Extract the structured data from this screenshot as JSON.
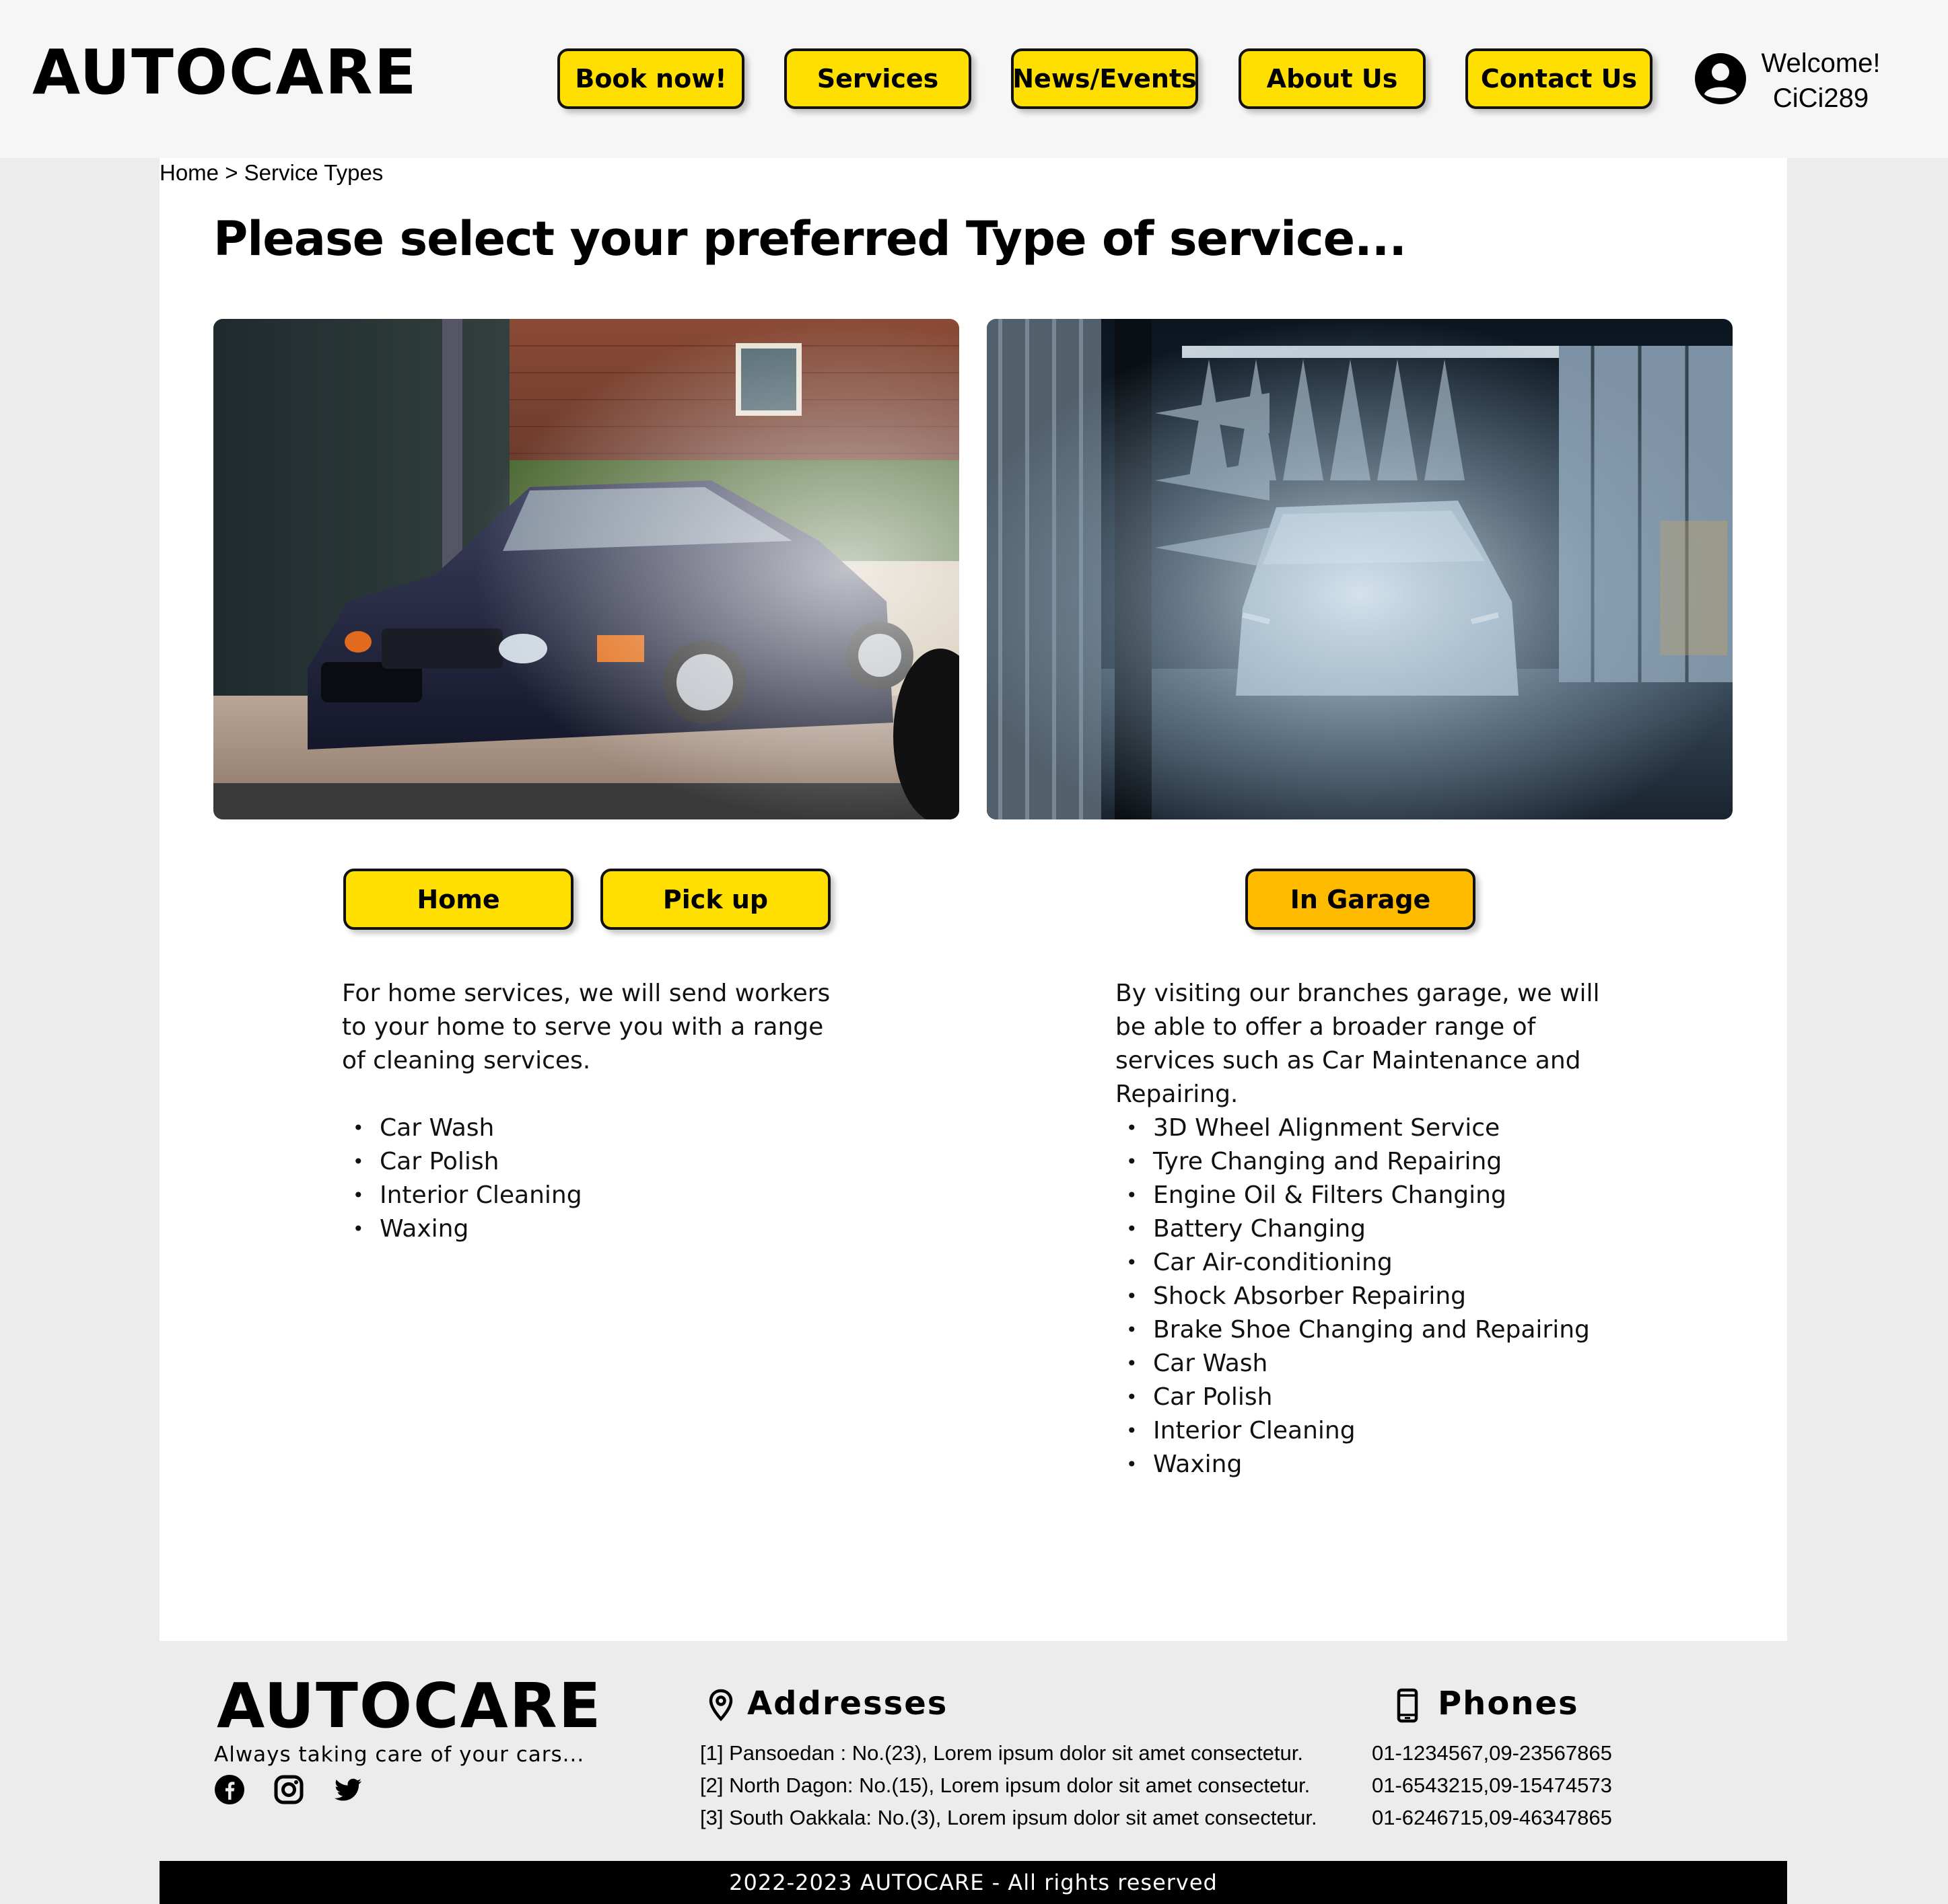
{
  "brand": {
    "name": "AUTOCARE"
  },
  "nav": {
    "items": [
      {
        "label": "Book now!"
      },
      {
        "label": "Services"
      },
      {
        "label": "News/Events"
      },
      {
        "label": "About Us"
      },
      {
        "label": "Contact Us"
      }
    ]
  },
  "user": {
    "welcome": "Welcome!",
    "username": "CiCi289"
  },
  "breadcrumb": {
    "home": "Home",
    "separator": ">",
    "current": "Service Types"
  },
  "main": {
    "title": "Please select your preferred Type of service...",
    "home_option": {
      "buttons": [
        {
          "label": "Home"
        },
        {
          "label": "Pick up"
        }
      ],
      "description": "For home services, we will send workers to your home to serve you with a range of cleaning services.",
      "items": [
        "Car Wash",
        "Car Polish",
        "Interior Cleaning",
        "Waxing"
      ]
    },
    "garage_option": {
      "button": {
        "label": "In Garage",
        "selected": true
      },
      "description": "By visiting our branches garage, we will be able to offer a broader range of services such as Car Maintenance and Repairing.",
      "items": [
        "3D Wheel Alignment Service",
        "Tyre Changing and Repairing",
        "Engine Oil & Filters Changing",
        "Battery Changing",
        "Car Air-conditioning",
        "Shock Absorber Repairing",
        "Brake Shoe Changing and Repairing",
        "Car Wash",
        "Car Polish",
        "Interior Cleaning",
        "Waxing"
      ]
    }
  },
  "footer": {
    "brand": "AUTOCARE",
    "tagline": "Always taking care of your cars...",
    "social_icons": [
      "facebook-icon",
      "instagram-icon",
      "twitter-icon"
    ],
    "addresses_heading": "Addresses",
    "addresses": [
      "[1] Pansoedan : No.(23), Lorem ipsum dolor sit amet consectetur.",
      "[2] North Dagon: No.(15), Lorem ipsum dolor sit amet consectetur.",
      "[3] South Oakkala: No.(3), Lorem ipsum dolor sit amet consectetur."
    ],
    "phones_heading": "Phones",
    "phones": [
      "01-1234567,09-23567865",
      "01-6543215,09-15474573",
      "01-6246715,09-46347865"
    ],
    "copyright": "2022-2023 AUTOCARE - All rights reserved"
  },
  "colors": {
    "accent": "#ffdf00",
    "accent_selected": "#ffbb00",
    "header_bg": "#f6f6f6",
    "page_bg": "#ececec",
    "footer_bar": "#000000"
  }
}
